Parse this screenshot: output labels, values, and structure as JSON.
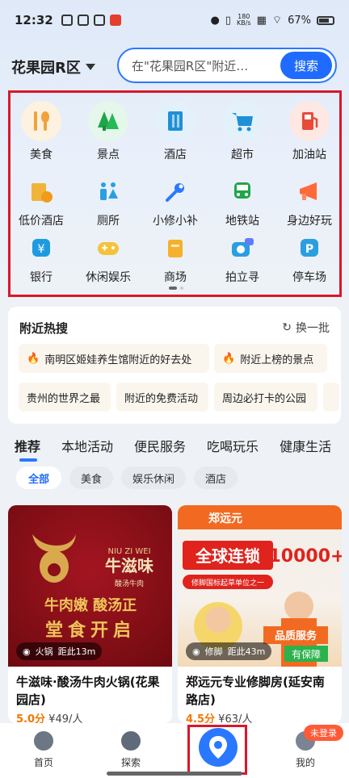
{
  "status_bar": {
    "time": "12:32",
    "net_speed_top": "180",
    "net_speed_bottom": "KB/s",
    "battery": "67%"
  },
  "location": {
    "name": "花果园R区"
  },
  "search": {
    "placeholder": "在\"花果园R区\"附近…",
    "button": "搜索"
  },
  "categories": [
    {
      "label": "美食",
      "icon": "food-icon",
      "color": "#f1a23b"
    },
    {
      "label": "景点",
      "icon": "tree-icon",
      "color": "#1fa64a"
    },
    {
      "label": "酒店",
      "icon": "building-icon",
      "color": "#1e90d6"
    },
    {
      "label": "超市",
      "icon": "cart-icon",
      "color": "#1e90d6"
    },
    {
      "label": "加油站",
      "icon": "fuel-icon",
      "color": "#e84a3a"
    },
    {
      "label": "低价酒店",
      "icon": "discount-hotel-icon",
      "color": "#f1b43b"
    },
    {
      "label": "厕所",
      "icon": "restroom-icon",
      "color": "#2a9fe0"
    },
    {
      "label": "小修小补",
      "icon": "wrench-icon",
      "color": "#2a78ff"
    },
    {
      "label": "地铁站",
      "icon": "metro-icon",
      "color": "#1fa64a"
    },
    {
      "label": "身边好玩",
      "icon": "megaphone-icon",
      "color": "#ff6a3b"
    },
    {
      "label": "银行",
      "icon": "bank-icon",
      "color": "#1e9be0"
    },
    {
      "label": "休闲娱乐",
      "icon": "gamepad-icon",
      "color": "#f5c23b"
    },
    {
      "label": "商场",
      "icon": "mall-icon",
      "color": "#f5b12b"
    },
    {
      "label": "拍立寻",
      "icon": "camera-ai-icon",
      "color": "#2a9fe0"
    },
    {
      "label": "停车场",
      "icon": "parking-icon",
      "color": "#2a9fe0"
    }
  ],
  "hot": {
    "title": "附近热搜",
    "refresh": "换一批",
    "items": [
      "南明区姬娃养生馆附近的好去处",
      "附近上榜的景点",
      "贵州的世界之最",
      "附近的免费活动",
      "周边必打卡的公园"
    ]
  },
  "tabs": [
    "推荐",
    "本地活动",
    "便民服务",
    "吃喝玩乐",
    "健康生活"
  ],
  "chips": [
    "全部",
    "美食",
    "娱乐休闲",
    "酒店"
  ],
  "cards": [
    {
      "tag": "火锅",
      "distance": "距此13m",
      "title": "牛滋味·酸汤牛肉火锅(花果园店)",
      "score": "5.0分",
      "price": "¥49/人",
      "img_brand_pinyin": "NIU ZI WEI",
      "img_brand": "牛滋味",
      "img_sub": "酸汤牛肉",
      "img_slogan": "牛肉嫩 酸汤正",
      "img_promo": "堂食开启"
    },
    {
      "tag": "修脚",
      "distance": "距此43m",
      "title": "郑远元专业修脚房(延安南路店)",
      "score": "4.5分",
      "price": "¥63/人",
      "img_brand": "郑远元",
      "img_slogan": "全球连锁",
      "img_count": "10000+",
      "img_sub": "修脚国标起草单位之一",
      "img_service": "品质服务",
      "img_guarantee": "有保障"
    }
  ],
  "nav": {
    "home": "首页",
    "explore": "探索",
    "me": "我的",
    "login_badge": "未登录"
  }
}
